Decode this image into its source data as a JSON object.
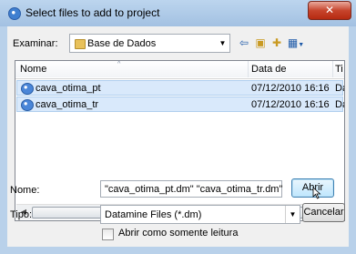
{
  "window": {
    "title": "Select files to add to project",
    "close_glyph": "✕"
  },
  "toolbar": {
    "look_in_label": "Examinar:",
    "look_in_value": "Base de Dados",
    "back_icon": "back-arrow-icon",
    "up_icon": "up-folder-icon",
    "new_folder_icon": "new-folder-icon",
    "views_icon": "views-menu-icon"
  },
  "list": {
    "columns": [
      "Nome",
      "Data de modificaç...",
      "Ti"
    ],
    "rows": [
      {
        "name": "cava_otima_pt",
        "date": "07/12/2010 16:16",
        "type": "Da"
      },
      {
        "name": "cava_otima_tr",
        "date": "07/12/2010 16:16",
        "type": "Da"
      }
    ],
    "scroll_thumb_glyph": "III"
  },
  "form": {
    "name_label": "Nome:",
    "name_value": "\"cava_otima_pt.dm\" \"cava_otima_tr.dm\"",
    "type_label": "Tipo:",
    "type_value": "Datamine Files (*.dm)",
    "readonly_label": "Abrir como somente leitura",
    "open_button": "Abrir",
    "cancel_button": "Cancelar"
  }
}
